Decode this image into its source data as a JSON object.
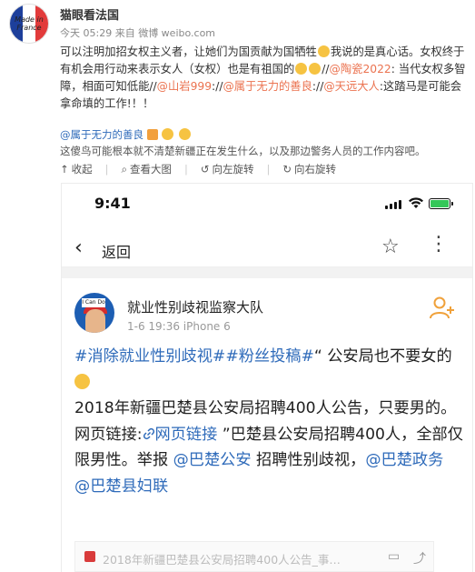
{
  "top_post": {
    "avatar_text": "Made in France",
    "username": "猫眼看法国",
    "meta": "今天 05:29 来自 微博 weibo.com",
    "body": {
      "seg1": "可以注明加招女权主义者，让她们为国贡献为国牺牲",
      "seg2": "我说的是真心话。女权终于有机会用行动来表示女人（女权）也是有祖国的",
      "seg3": "//",
      "mention1": "@陶瓷2022",
      "seg4": ": 当代女权多智障，相面可知低能//",
      "mention2": "@山岩999",
      "seg5": ":",
      "seg6": "//",
      "mention3": "@属于无力的善良",
      "seg7": ":",
      "seg8": "//",
      "mention4": "@天远大人",
      "seg9": ":这踏马是可能会拿命填的工作!！！"
    },
    "comment": {
      "author": "@属于无力的善良",
      "text": "这傻鸟可能根本就不清楚新疆正在发生什么，以及那边警务人员的工作内容吧。"
    },
    "actions": {
      "collapse": "收起",
      "view_large": "查看大图",
      "rotate_left": "向左旋转",
      "rotate_right": "向右旋转"
    }
  },
  "phone": {
    "status_time": "9:41",
    "nav": {
      "back_label": "返回"
    },
    "post": {
      "avatar_banner": "I Can Do",
      "name": "就业性别歧视监察大队",
      "meta": "1-6 19:36  iPhone 6",
      "hashtag1": "#消除就业性别歧视#",
      "hashtag2": "#粉丝投稿#",
      "line1_rest": "“ 公安局也不要女的",
      "line2": "2018年新疆巴楚县公安局招聘400人公告，只要男的。网页链接:",
      "web_link": "网页链接",
      "line3": "”巴楚县公安局招聘400人，全部仅限男性。举报",
      "mention_police": "@巴楚公安",
      "line4": "招聘性别歧视，",
      "mention_gov": "@巴楚政务",
      "mention_women": "@巴楚县妇联",
      "card_text": "2018年新疆巴楚县公安局招聘400人公告_事…"
    }
  },
  "colors": {
    "link_orange": "#eb7350",
    "link_blue": "#2f6bba",
    "battery_green": "#34c759"
  }
}
